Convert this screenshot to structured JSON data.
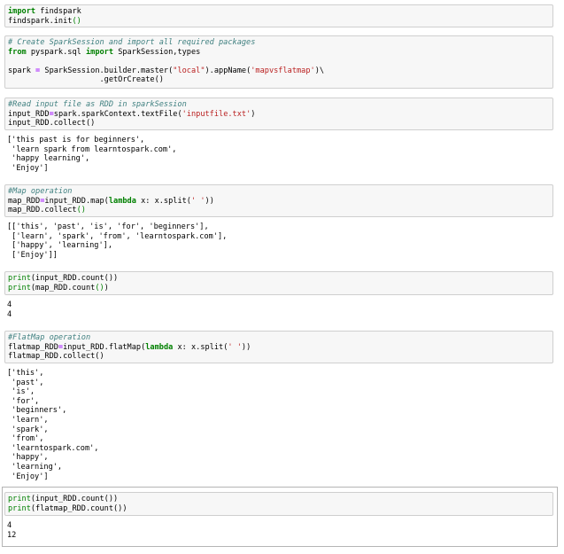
{
  "cells": [
    {
      "id": "cell1",
      "input": [
        [
          {
            "t": "import",
            "c": "kw"
          },
          {
            "t": " findspark"
          }
        ],
        [
          {
            "t": "findspark.init"
          },
          {
            "t": "()",
            "c": "bi"
          }
        ]
      ],
      "output": []
    },
    {
      "id": "cell2",
      "input": [
        [
          {
            "t": "# Create SparkSession and import all required packages",
            "c": "cm"
          }
        ],
        [
          {
            "t": "from",
            "c": "kw"
          },
          {
            "t": " pyspark.sql "
          },
          {
            "t": "import",
            "c": "kw"
          },
          {
            "t": " SparkSession,types"
          }
        ],
        [
          {
            "t": ""
          }
        ],
        [
          {
            "t": "spark "
          },
          {
            "t": "=",
            "c": "op"
          },
          {
            "t": " SparkSession.builder.master("
          },
          {
            "t": "\"local\"",
            "c": "str"
          },
          {
            "t": ").appName("
          },
          {
            "t": "'mapvsflatmap'",
            "c": "str"
          },
          {
            "t": ")\\"
          }
        ],
        [
          {
            "t": "                    .getOrCreate()"
          }
        ]
      ],
      "output": []
    },
    {
      "id": "cell3",
      "input": [
        [
          {
            "t": "#Read input file as RDD in sparkSession",
            "c": "cm"
          }
        ],
        [
          {
            "t": "input_RDD"
          },
          {
            "t": "=",
            "c": "op"
          },
          {
            "t": "spark.sparkContext.textFile("
          },
          {
            "t": "'inputfile.txt'",
            "c": "str"
          },
          {
            "t": ")"
          }
        ],
        [
          {
            "t": "input_RDD.collect()"
          }
        ]
      ],
      "output": [
        "['this past is for beginners',",
        " 'learn spark from learntospark.com',",
        " 'happy learning',",
        " 'Enjoy']"
      ]
    },
    {
      "id": "cell4",
      "input": [
        [
          {
            "t": "#Map operation",
            "c": "cm"
          }
        ],
        [
          {
            "t": "map_RDD"
          },
          {
            "t": "=",
            "c": "op"
          },
          {
            "t": "input_RDD.map("
          },
          {
            "t": "lambda",
            "c": "kw"
          },
          {
            "t": " x: x.split("
          },
          {
            "t": "' '",
            "c": "str"
          },
          {
            "t": "))"
          }
        ],
        [
          {
            "t": "map_RDD.collect"
          },
          {
            "t": "()",
            "c": "bi"
          }
        ]
      ],
      "output": [
        "[['this', 'past', 'is', 'for', 'beginners'],",
        " ['learn', 'spark', 'from', 'learntospark.com'],",
        " ['happy', 'learning'],",
        " ['Enjoy']]"
      ]
    },
    {
      "id": "cell5",
      "input": [
        [
          {
            "t": "print",
            "c": "bi"
          },
          {
            "t": "(input_RDD.count())"
          }
        ],
        [
          {
            "t": "print",
            "c": "bi"
          },
          {
            "t": "(map_RDD.count"
          },
          {
            "t": "()",
            "c": "bi"
          },
          {
            "t": ")"
          }
        ]
      ],
      "output": [
        "4",
        "4"
      ]
    },
    {
      "id": "cell6",
      "input": [
        [
          {
            "t": "#FlatMap operation",
            "c": "cm"
          }
        ],
        [
          {
            "t": "flatmap_RDD"
          },
          {
            "t": "=",
            "c": "op"
          },
          {
            "t": "input_RDD.flatMap("
          },
          {
            "t": "lambda",
            "c": "kw"
          },
          {
            "t": " x: x.split("
          },
          {
            "t": "' '",
            "c": "str"
          },
          {
            "t": "))"
          }
        ],
        [
          {
            "t": "flatmap_RDD.collect()"
          }
        ]
      ],
      "output": [
        "['this',",
        " 'past',",
        " 'is',",
        " 'for',",
        " 'beginners',",
        " 'learn',",
        " 'spark',",
        " 'from',",
        " 'learntospark.com',",
        " 'happy',",
        " 'learning',",
        " 'Enjoy']"
      ]
    },
    {
      "id": "cell7",
      "input": [
        [
          {
            "t": "print",
            "c": "bi"
          },
          {
            "t": "(input_RDD.count())"
          }
        ],
        [
          {
            "t": "print",
            "c": "bi"
          },
          {
            "t": "(flatmap_RDD.count())"
          }
        ]
      ],
      "output": [
        "4",
        "12"
      ]
    }
  ]
}
